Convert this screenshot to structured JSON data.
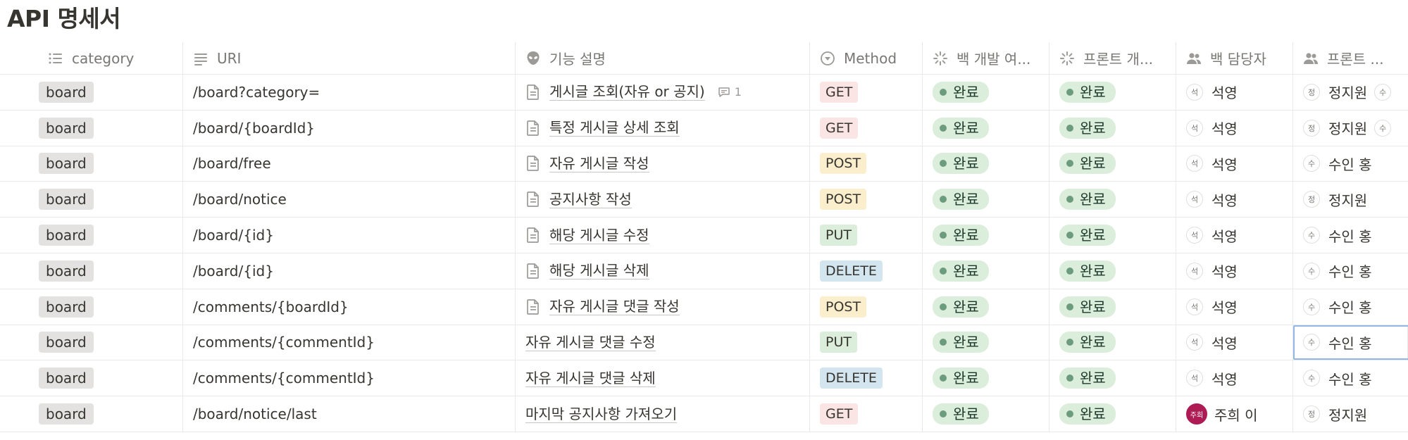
{
  "page": {
    "title": "API 명세서"
  },
  "columns": {
    "category": "category",
    "uri": "URI",
    "description": "기능 설명",
    "method": "Method",
    "backend_progress": "백 개발 여...",
    "frontend_progress": "프론트 개...",
    "backend_owner": "백 담당자",
    "frontend_owner": "프론트 ..."
  },
  "rows": [
    {
      "category": "board",
      "uri": "/board?category=",
      "description": "게시글 조회(자유 or 공지)",
      "has_doc": true,
      "comment_count": "1",
      "method": "GET",
      "back": "완료",
      "front": "완료",
      "back_owner": "석영",
      "back_initial": "석",
      "front_owner": "정지원",
      "front_initial": "정",
      "extra_initial": "수"
    },
    {
      "category": "board",
      "uri": "/board/{boardId}",
      "description": "특정 게시글 상세 조회",
      "has_doc": true,
      "comment_count": "",
      "method": "GET",
      "back": "완료",
      "front": "완료",
      "back_owner": "석영",
      "back_initial": "석",
      "front_owner": "정지원",
      "front_initial": "정",
      "extra_initial": "수"
    },
    {
      "category": "board",
      "uri": "/board/free",
      "description": "자유 게시글 작성",
      "has_doc": true,
      "comment_count": "",
      "method": "POST",
      "back": "완료",
      "front": "완료",
      "back_owner": "석영",
      "back_initial": "석",
      "front_owner": "수인 홍",
      "front_initial": "수",
      "extra_initial": ""
    },
    {
      "category": "board",
      "uri": "/board/notice",
      "description": "공지사항 작성",
      "has_doc": true,
      "comment_count": "",
      "method": "POST",
      "back": "완료",
      "front": "완료",
      "back_owner": "석영",
      "back_initial": "석",
      "front_owner": "정지원",
      "front_initial": "정",
      "extra_initial": ""
    },
    {
      "category": "board",
      "uri": "/board/{id}",
      "description": "해당 게시글 수정",
      "has_doc": true,
      "comment_count": "",
      "method": "PUT",
      "back": "완료",
      "front": "완료",
      "back_owner": "석영",
      "back_initial": "석",
      "front_owner": "수인 홍",
      "front_initial": "수",
      "extra_initial": ""
    },
    {
      "category": "board",
      "uri": "/board/{id}",
      "description": "해당 게시글 삭제",
      "has_doc": true,
      "comment_count": "",
      "method": "DELETE",
      "back": "완료",
      "front": "완료",
      "back_owner": "석영",
      "back_initial": "석",
      "front_owner": "수인 홍",
      "front_initial": "수",
      "extra_initial": ""
    },
    {
      "category": "board",
      "uri": "/comments/{boardId}",
      "description": "자유 게시글 댓글 작성",
      "has_doc": true,
      "comment_count": "",
      "method": "POST",
      "back": "완료",
      "front": "완료",
      "back_owner": "석영",
      "back_initial": "석",
      "front_owner": "수인 홍",
      "front_initial": "수",
      "extra_initial": ""
    },
    {
      "category": "board",
      "uri": "/comments/{commentId}",
      "description": "자유 게시글 댓글 수정",
      "has_doc": false,
      "comment_count": "",
      "method": "PUT",
      "back": "완료",
      "front": "완료",
      "back_owner": "석영",
      "back_initial": "석",
      "front_owner": "수인 홍",
      "front_initial": "수",
      "extra_initial": "",
      "selected": true
    },
    {
      "category": "board",
      "uri": "/comments/{commentId}",
      "description": "자유 게시글 댓글 삭제",
      "has_doc": false,
      "comment_count": "",
      "method": "DELETE",
      "back": "완료",
      "front": "완료",
      "back_owner": "석영",
      "back_initial": "석",
      "front_owner": "수인 홍",
      "front_initial": "수",
      "extra_initial": ""
    },
    {
      "category": "board",
      "uri": "/board/notice/last",
      "description": "마지막 공지사항 가져오기",
      "has_doc": false,
      "comment_count": "",
      "method": "GET",
      "back": "완료",
      "front": "완료",
      "back_owner": "주희 이",
      "back_initial": "주희",
      "back_avatar_filled": true,
      "front_owner": "정지원",
      "front_initial": "정",
      "extra_initial": ""
    }
  ],
  "colors": {
    "get": "#fbe4e4",
    "post": "#fbeecc",
    "put": "#dbeddb",
    "delete": "#d3e5ef",
    "status_bg": "#dbeddb",
    "status_dot": "#6c9b7d",
    "avatar_filled": "#ad1a54"
  }
}
